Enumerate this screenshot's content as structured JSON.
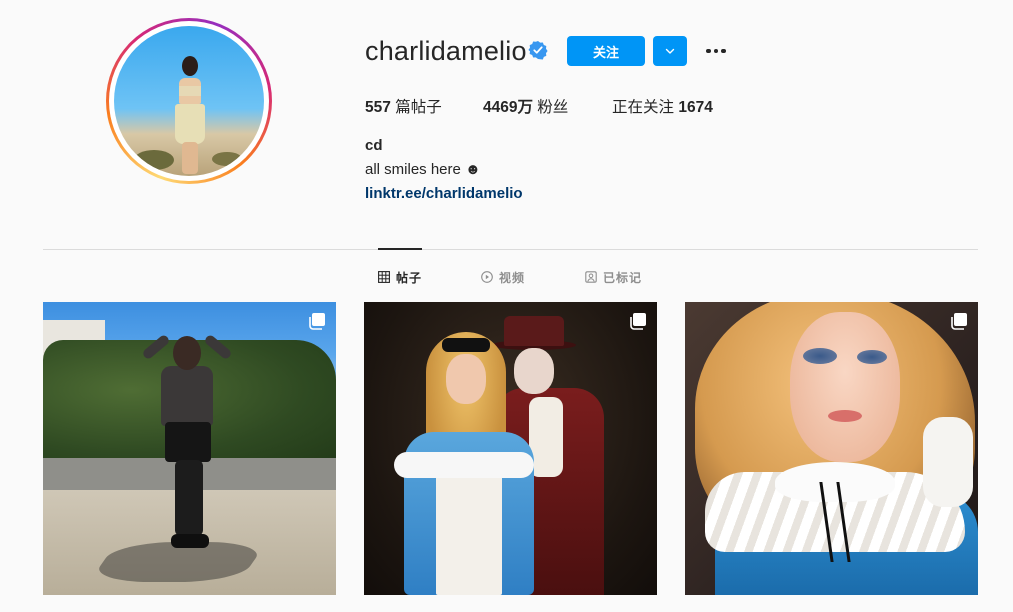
{
  "profile": {
    "username": "charlidamelio",
    "follow_label": "关注",
    "stats": {
      "posts_count": "557",
      "posts_label": "篇帖子",
      "followers_count": "4469万",
      "followers_label": "粉丝",
      "following_label": "正在关注",
      "following_count": "1674"
    },
    "full_name": "cd",
    "bio": "all smiles here ☻",
    "link": "linktr.ee/charlidamelio"
  },
  "tabs": [
    {
      "label": "帖子",
      "icon": "grid-icon",
      "active": true
    },
    {
      "label": "视频",
      "icon": "play-icon",
      "active": false
    },
    {
      "label": "已标记",
      "icon": "tagged-icon",
      "active": false
    }
  ],
  "colors": {
    "accent": "#0095f6",
    "link": "#00376b",
    "verified": "#3897f0",
    "text": "#262626",
    "muted": "#8e8e8e"
  },
  "posts": [
    {
      "icon": "multiple-posts-icon"
    },
    {
      "icon": "multiple-posts-icon"
    },
    {
      "icon": "multiple-posts-icon"
    }
  ]
}
